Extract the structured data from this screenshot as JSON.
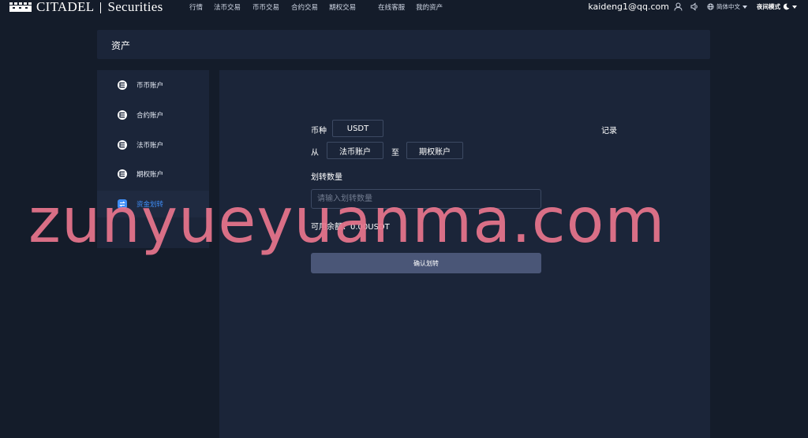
{
  "brand": {
    "name": "CITADEL",
    "suffix": "Securities"
  },
  "nav": {
    "items": [
      "行情",
      "法币交易",
      "币币交易",
      "合约交易",
      "期权交易",
      "在线客服",
      "我的资产"
    ]
  },
  "user": {
    "email": "kaideng1@qq.com",
    "user_icon": "user-icon",
    "sound_icon": "speaker-icon",
    "language": "简体中文",
    "theme_label": "夜间模式"
  },
  "assets": {
    "title": "资产"
  },
  "sidebar": {
    "items": [
      {
        "label": "币币账户",
        "icon": "account-icon",
        "active": false
      },
      {
        "label": "合约账户",
        "icon": "account-icon",
        "active": false
      },
      {
        "label": "法币账户",
        "icon": "account-icon",
        "active": false
      },
      {
        "label": "期权账户",
        "icon": "account-icon",
        "active": false
      },
      {
        "label": "资金划转",
        "icon": "transfer-icon",
        "active": true
      }
    ]
  },
  "transfer": {
    "currency_label": "币种",
    "currency_value": "USDT",
    "records_label": "记录",
    "from_label": "从",
    "from_account": "法币账户",
    "to_label": "至",
    "to_account": "期权账户",
    "amount_label": "划转数量",
    "amount_placeholder": "请输入划转数量",
    "available": "可用余额：0.00USDT",
    "confirm_button": "确认划转"
  },
  "watermark": "zunyueyuanma.com",
  "colors": {
    "background": "#141c2a",
    "panel": "#1b2539",
    "accent": "#3f8ef7",
    "button": "#4a5677",
    "watermark": "#e9758d"
  }
}
